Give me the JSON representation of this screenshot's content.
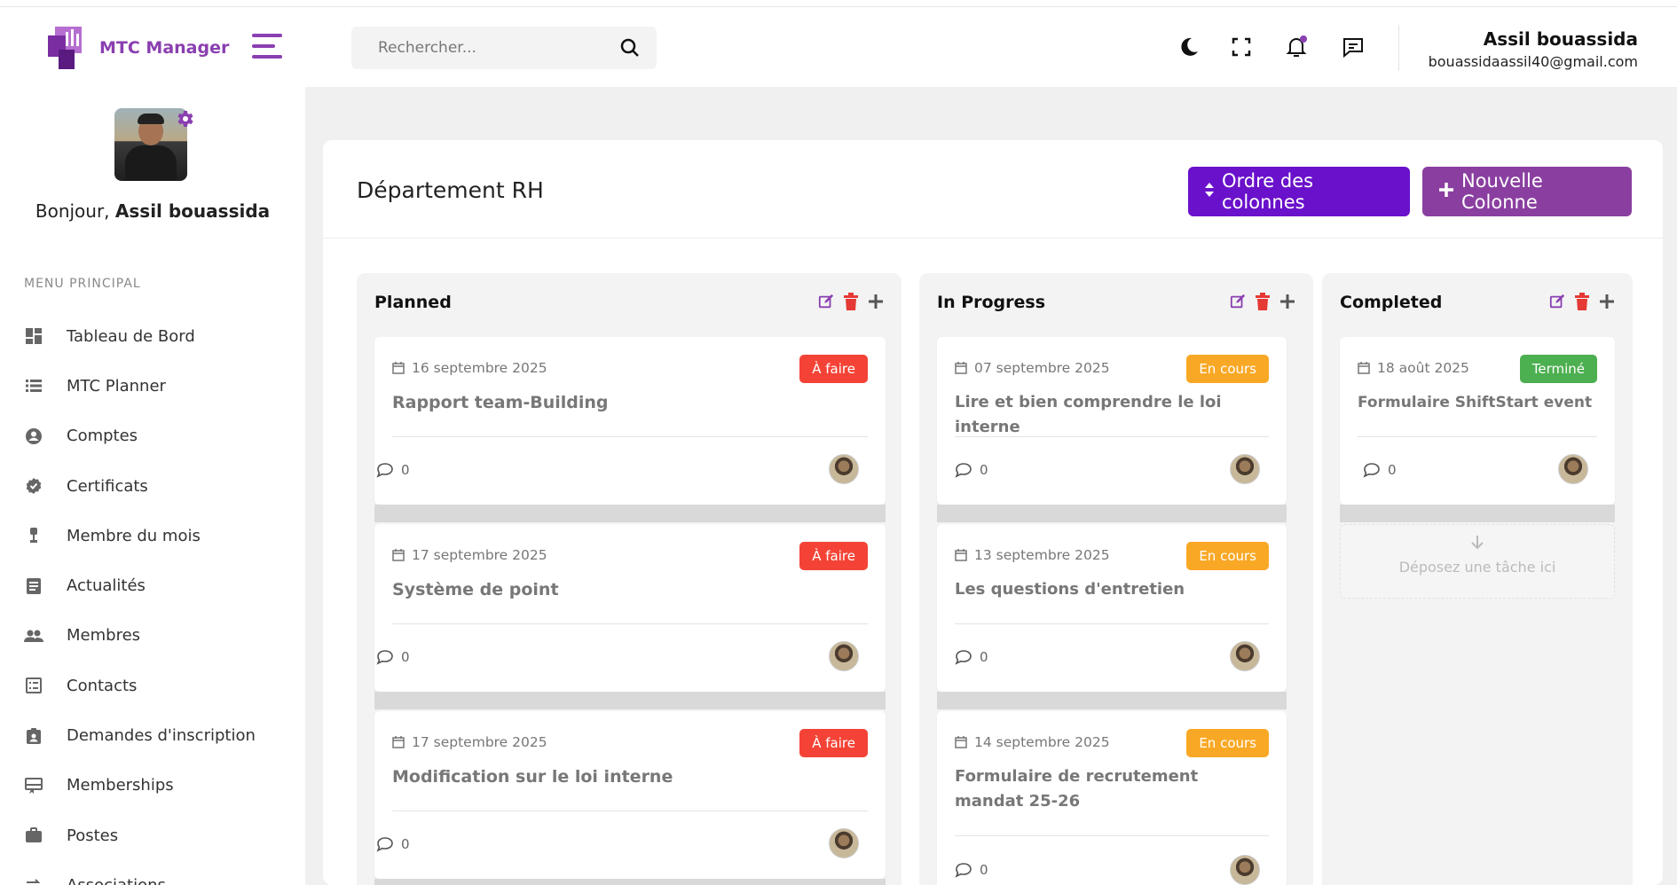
{
  "app": {
    "name": "MTC Manager"
  },
  "colors": {
    "brand": "#8a3fb0",
    "order_button": "#6a11cb",
    "new_button": "#8a3fa0",
    "todo": "#f44336",
    "in_progress": "#f9a825",
    "done": "#4caf50"
  },
  "sidebar": {
    "greeting_prefix": "Bonjour, ",
    "greeting_name": "Assil bouassida",
    "menu_title": "MENU PRINCIPAL",
    "items": [
      {
        "label": "Tableau de Bord",
        "icon": "dashboard-icon"
      },
      {
        "label": "MTC Planner",
        "icon": "list-icon"
      },
      {
        "label": "Comptes",
        "icon": "account-circle-icon"
      },
      {
        "label": "Certificats",
        "icon": "verified-icon"
      },
      {
        "label": "Membre du mois",
        "icon": "trophy-icon"
      },
      {
        "label": "Actualités",
        "icon": "article-icon"
      },
      {
        "label": "Membres",
        "icon": "group-icon"
      },
      {
        "label": "Contacts",
        "icon": "contacts-list-icon"
      },
      {
        "label": "Demandes d'inscription",
        "icon": "badge-icon"
      },
      {
        "label": "Memberships",
        "icon": "card-membership-icon"
      },
      {
        "label": "Postes",
        "icon": "briefcase-icon"
      },
      {
        "label": "Associations",
        "icon": "swap-icon"
      }
    ]
  },
  "header": {
    "search_placeholder": "Rechercher...",
    "user_name": "Assil bouassida",
    "user_email": "bouassidaassil40@gmail.com"
  },
  "page": {
    "title": "Département RH",
    "order_button": "Ordre des colonnes",
    "new_column_button": "Nouvelle Colonne"
  },
  "columns": [
    {
      "title": "Planned",
      "tasks": [
        {
          "date": "16 septembre 2025",
          "status": "À faire",
          "title": "Rapport team-Building",
          "comments": "0"
        },
        {
          "date": "17 septembre 2025",
          "status": "À faire",
          "title": "Système de point",
          "comments": "0"
        },
        {
          "date": "17 septembre 2025",
          "status": "À faire",
          "title": "Modification sur le loi interne",
          "comments": "0"
        }
      ]
    },
    {
      "title": "In Progress",
      "tasks": [
        {
          "date": "07 septembre 2025",
          "status": "En cours",
          "title": "Lire et bien comprendre le loi interne",
          "comments": "0"
        },
        {
          "date": "13 septembre 2025",
          "status": "En cours",
          "title": "Les questions d'entretien",
          "comments": "0"
        },
        {
          "date": "14 septembre 2025",
          "status": "En cours",
          "title": "Formulaire de recrutement mandat 25-26",
          "comments": "0"
        }
      ]
    },
    {
      "title": "Completed",
      "tasks": [
        {
          "date": "18 août 2025",
          "status": "Terminé",
          "title": "Formulaire ShiftStart event",
          "comments": "0"
        }
      ],
      "drop_label": "Déposez une tâche ici"
    }
  ]
}
